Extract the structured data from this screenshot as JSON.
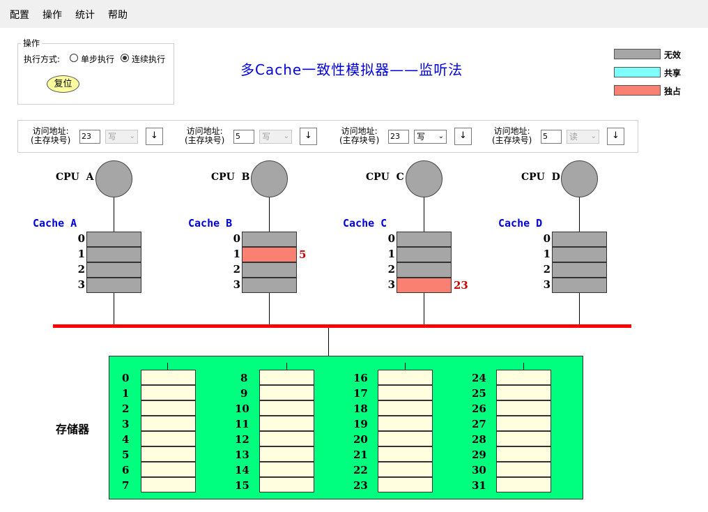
{
  "menu": [
    "配置",
    "操作",
    "统计",
    "帮助"
  ],
  "operation": {
    "group_label": "操作",
    "mode_label": "执行方式:",
    "modes": [
      "单步执行",
      "连续执行"
    ],
    "selected_mode": "连续执行",
    "reset_label": "复位"
  },
  "title": "多Cache一致性模拟器——监听法",
  "legend": [
    {
      "label": "无效",
      "color": "#a6a6a6"
    },
    {
      "label": "共享",
      "color": "#80ffff"
    },
    {
      "label": "独占",
      "color": "#fa8072"
    }
  ],
  "access": {
    "label_line1": "访问地址:",
    "label_line2": "(主存块号)",
    "go_symbol": "↓",
    "panels": [
      {
        "address": "23",
        "op": "写",
        "enabled": false
      },
      {
        "address": "5",
        "op": "写",
        "enabled": false
      },
      {
        "address": "23",
        "op": "写",
        "enabled": true
      },
      {
        "address": "5",
        "op": "读",
        "enabled": false
      }
    ]
  },
  "cpus": [
    {
      "label": "CPU  A",
      "cache_label": "Cache A",
      "blocks": [
        {
          "index": "0",
          "state": "invalid",
          "addr": ""
        },
        {
          "index": "1",
          "state": "invalid",
          "addr": ""
        },
        {
          "index": "2",
          "state": "invalid",
          "addr": ""
        },
        {
          "index": "3",
          "state": "invalid",
          "addr": ""
        }
      ]
    },
    {
      "label": "CPU  B",
      "cache_label": "Cache B",
      "blocks": [
        {
          "index": "0",
          "state": "invalid",
          "addr": ""
        },
        {
          "index": "1",
          "state": "exclusive",
          "addr": "5"
        },
        {
          "index": "2",
          "state": "invalid",
          "addr": ""
        },
        {
          "index": "3",
          "state": "invalid",
          "addr": ""
        }
      ]
    },
    {
      "label": "CPU  C",
      "cache_label": "Cache C",
      "blocks": [
        {
          "index": "0",
          "state": "invalid",
          "addr": ""
        },
        {
          "index": "1",
          "state": "invalid",
          "addr": ""
        },
        {
          "index": "2",
          "state": "invalid",
          "addr": ""
        },
        {
          "index": "3",
          "state": "exclusive",
          "addr": "23"
        }
      ]
    },
    {
      "label": "CPU  D",
      "cache_label": "Cache D",
      "blocks": [
        {
          "index": "0",
          "state": "invalid",
          "addr": ""
        },
        {
          "index": "1",
          "state": "invalid",
          "addr": ""
        },
        {
          "index": "2",
          "state": "invalid",
          "addr": ""
        },
        {
          "index": "3",
          "state": "invalid",
          "addr": ""
        }
      ]
    }
  ],
  "memory": {
    "label": "存储器",
    "blocks": [
      "0",
      "1",
      "2",
      "3",
      "4",
      "5",
      "6",
      "7",
      "8",
      "9",
      "10",
      "11",
      "12",
      "13",
      "14",
      "15",
      "16",
      "17",
      "18",
      "19",
      "20",
      "21",
      "22",
      "23",
      "24",
      "25",
      "26",
      "27",
      "28",
      "29",
      "30",
      "31"
    ]
  },
  "colors": {
    "invalid": "#a6a6a6",
    "shared": "#80ffff",
    "exclusive": "#fa8072",
    "bus": "#ff0000",
    "memory_bg": "#00ff7f",
    "memory_cell": "#ffffe0",
    "title": "#0000dd"
  }
}
